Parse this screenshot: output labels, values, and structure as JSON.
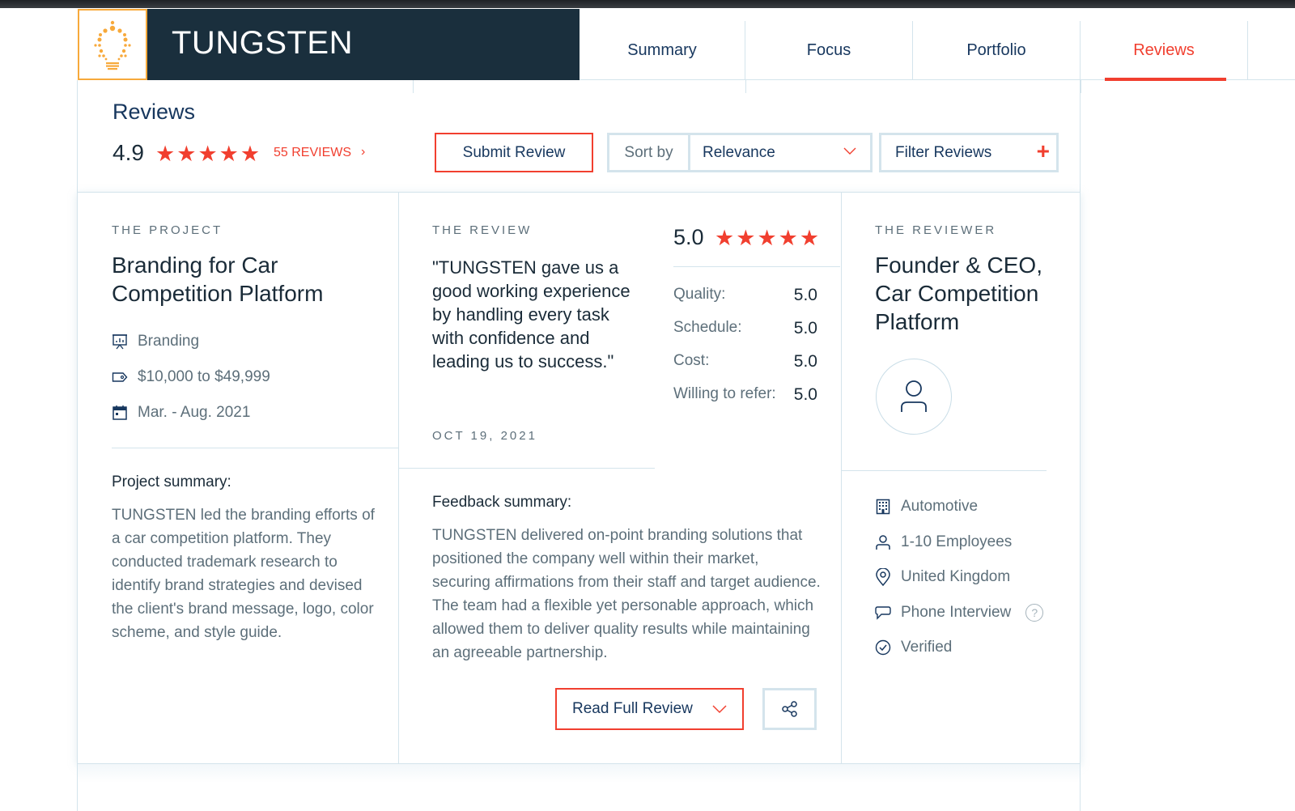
{
  "company": {
    "name": "TUNGSTEN",
    "logo_icon": "lightbulb-dots-icon"
  },
  "colors": {
    "accent": "#f13f2f",
    "navy": "#17375e",
    "brand_bar": "#1a2f3d",
    "logo_border": "#f7a93b",
    "border": "#d4e4ec",
    "muted_text": "#5d6f7a"
  },
  "tabs": [
    {
      "label": "Summary",
      "active": false
    },
    {
      "label": "Focus",
      "active": false
    },
    {
      "label": "Portfolio",
      "active": false
    },
    {
      "label": "Reviews",
      "active": true
    }
  ],
  "reviews_header": {
    "title": "Reviews",
    "overall_rating": "4.9",
    "overall_stars": 5,
    "reviews_count_label": "55 REVIEWS",
    "reviews_chevron": "›",
    "submit_review_label": "Submit Review",
    "sort_by_label": "Sort by",
    "sort_value": "Relevance",
    "filter_label": "Filter Reviews",
    "filter_icon": "+"
  },
  "review": {
    "project": {
      "eyebrow": "THE PROJECT",
      "title": "Branding for Car Competition Platform",
      "service": "Branding",
      "budget": "$10,000 to $49,999",
      "timeline": "Mar. - Aug. 2021",
      "summary_label": "Project summary:",
      "summary": "TUNGSTEN led the branding efforts of a car competition platform. They conducted trademark research to identify brand strategies and devised the client's brand message, logo, color scheme, and style guide."
    },
    "review": {
      "eyebrow": "THE REVIEW",
      "quote": "\"TUNGSTEN gave us a good working experience by handling every task with confidence and leading us to success.\"",
      "date": "OCT 19, 2021",
      "overall_score": "5.0",
      "overall_stars": 5,
      "scores": [
        {
          "label": "Quality:",
          "value": "5.0"
        },
        {
          "label": "Schedule:",
          "value": "5.0"
        },
        {
          "label": "Cost:",
          "value": "5.0"
        },
        {
          "label": "Willing to refer:",
          "value": "5.0"
        }
      ],
      "feedback_label": "Feedback summary:",
      "feedback": "TUNGSTEN delivered on-point branding solutions that positioned the company well within their market, securing affirmations from their staff and target audience. The team had a flexible yet personable approach, which allowed them to deliver quality results while maintaining an agreeable partnership.",
      "read_full_label": "Read Full Review"
    },
    "reviewer": {
      "eyebrow": "THE REVIEWER",
      "title": "Founder & CEO, Car Competition Platform",
      "industry": "Automotive",
      "size": "1-10 Employees",
      "location": "United Kingdom",
      "review_type": "Phone Interview",
      "help_glyph": "?",
      "status": "Verified"
    }
  }
}
